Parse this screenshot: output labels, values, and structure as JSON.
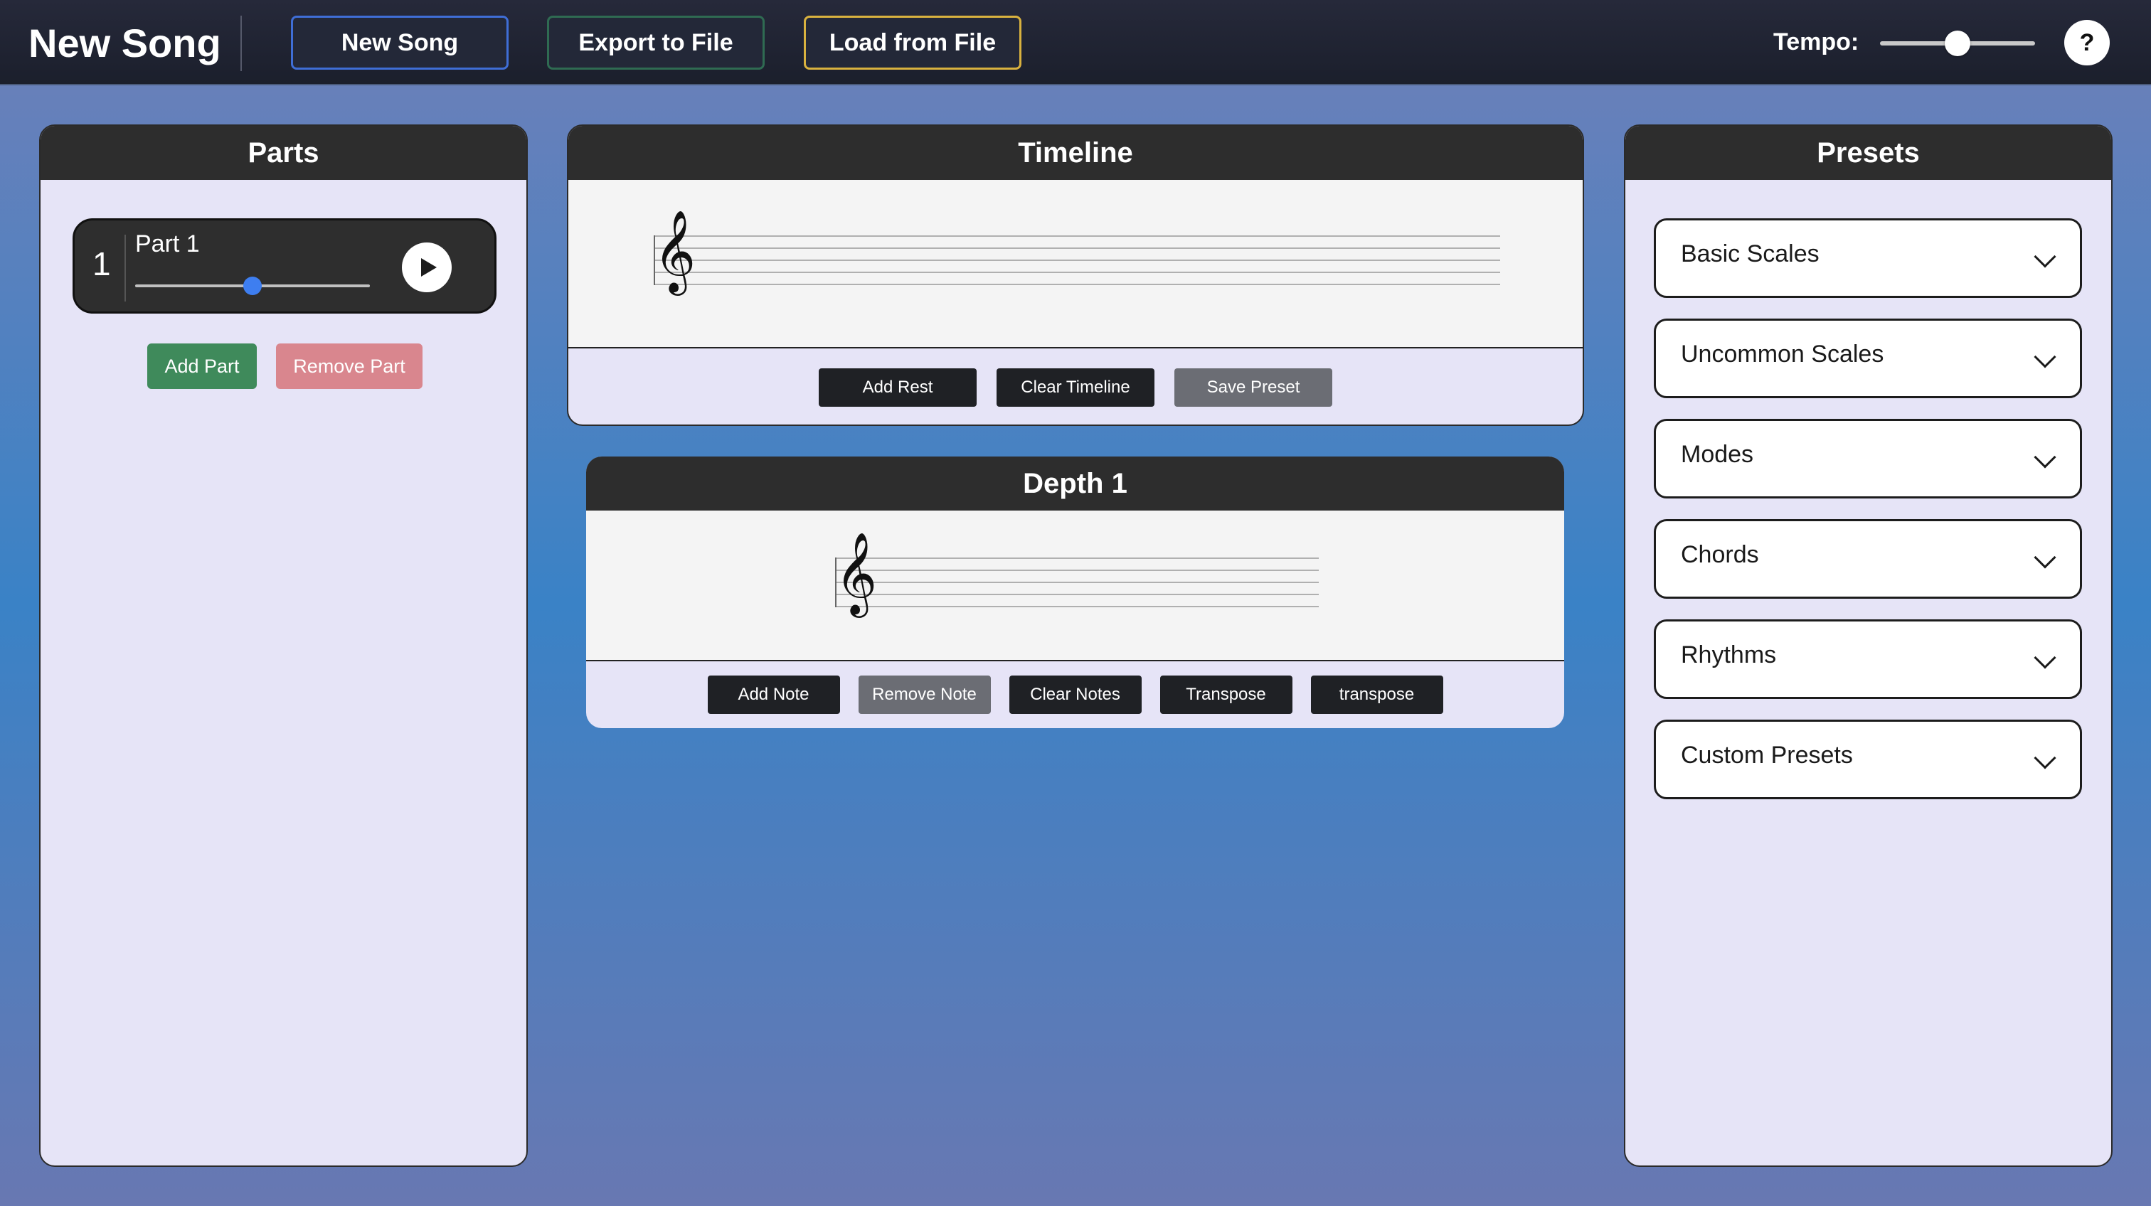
{
  "header": {
    "app_title": "New Song",
    "buttons": {
      "new_song": "New Song",
      "export": "Export to File",
      "load": "Load from File"
    },
    "tempo_label": "Tempo:",
    "tempo_level": 0.5,
    "help_label": "?"
  },
  "parts": {
    "title": "Parts",
    "items": [
      {
        "number": "1",
        "name": "Part 1",
        "volume_level": 0.5
      }
    ],
    "add_label": "Add Part",
    "remove_label": "Remove Part"
  },
  "timeline": {
    "title": "Timeline",
    "clef": "𝄞",
    "buttons": {
      "add_rest": "Add Rest",
      "clear": "Clear Timeline",
      "save_preset": "Save Preset"
    }
  },
  "depth": {
    "title": "Depth 1",
    "clef": "𝄞",
    "buttons": {
      "add_note": "Add Note",
      "remove_note": "Remove Note",
      "clear_notes": "Clear Notes",
      "transpose": "Transpose",
      "transpose_lower": "transpose"
    }
  },
  "presets": {
    "title": "Presets",
    "items": [
      "Basic Scales",
      "Uncommon Scales",
      "Modes",
      "Chords",
      "Rhythms",
      "Custom Presets"
    ]
  },
  "colors": {
    "topbar": "#1b1f2c",
    "accent_blue": "#3f6ed6",
    "accent_green": "#3f8a5b",
    "accent_yellow": "#d9b23f",
    "remove_pink": "#d9868e",
    "panel_bg": "#e6e4f7"
  }
}
